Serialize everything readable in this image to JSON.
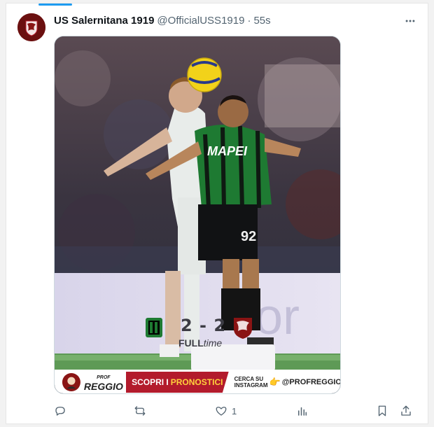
{
  "tweet": {
    "display_name": "US Salernitana 1919",
    "handle": "@OfficialUSS1919",
    "separator": "·",
    "timestamp": "55s"
  },
  "media": {
    "jersey_sponsor": "MAPEI",
    "jersey_number": "92",
    "board_text": "cor",
    "score": "2 - 2",
    "fulltime_bold": "FULL",
    "fulltime_rest": "time",
    "banner": {
      "brand_small": "PROF",
      "brand": "REGGIO",
      "cta_part1": "SCOPRI I",
      "cta_part2": "PRONOSTICI",
      "insta_line1": "CERCA SU",
      "insta_line2": "INSTAGRAM",
      "hand": "👉",
      "tag": "@PROFREGGIO"
    }
  },
  "actions": {
    "like_count": "1"
  },
  "colors": {
    "accent": "#1d9bf0",
    "brand_red": "#b31b2c",
    "sassuolo_green": "#1e7a32"
  }
}
